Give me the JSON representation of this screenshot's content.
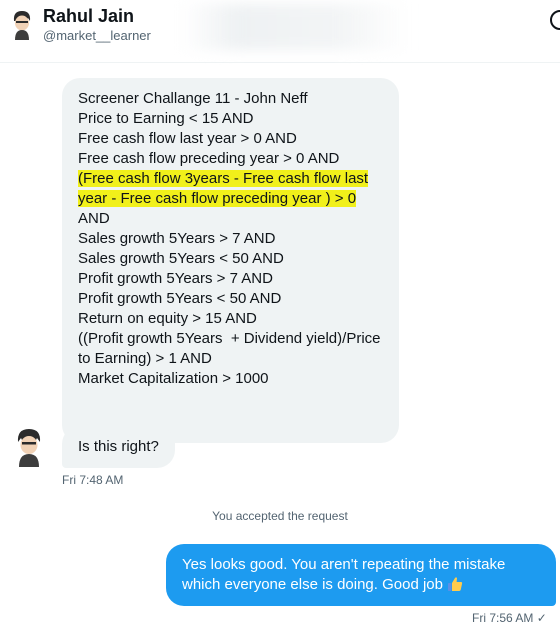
{
  "header": {
    "name": "Rahul Jain",
    "handle": "@market__learner"
  },
  "messages": {
    "long": {
      "lines": [
        "Screener Challange 11 - John Neff",
        "",
        "Price to Earning < 15 AND",
        "Free cash flow last year > 0 AND",
        "Free cash flow preceding year > 0 AND",
        "(Free cash flow 3years - Free cash flow last",
        "year - Free cash flow preceding year ) > 0",
        "AND",
        "Sales growth 5Years > 7 AND",
        "Sales growth 5Years < 50 AND",
        "Profit growth 5Years > 7 AND",
        "Profit growth 5Years < 50 AND",
        "Return on equity > 15 AND",
        "((Profit growth 5Years  + Dividend yield)/Price",
        "to Earning) > 1 AND",
        "Market Capitalization > 1000"
      ]
    },
    "short": {
      "text": "Is this right?",
      "time": "Fri 7:48 AM"
    },
    "system": "You accepted the request",
    "reply": {
      "text": "Yes looks good. You aren't repeating the mistake which everyone else is doing. Good job",
      "time": "Fri 7:56 AM",
      "status": "✓"
    }
  },
  "colors": {
    "highlight": "#f1f01a",
    "sent_bubble": "#1d9bf0",
    "received_bubble": "#eff3f4"
  },
  "icons": [
    "avatar",
    "info-icon",
    "thumbs-up-icon",
    "checkmark-icon"
  ]
}
